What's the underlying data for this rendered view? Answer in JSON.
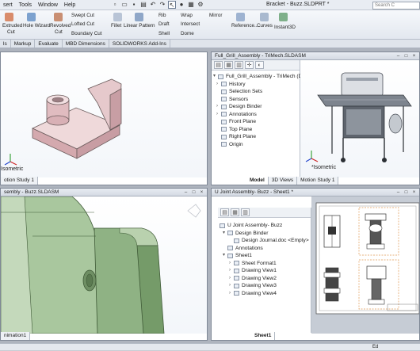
{
  "menubar": {
    "items": [
      "sert",
      "Tools",
      "Window",
      "Help"
    ]
  },
  "doc_title": "Bracket - Buzz.SLDPRT *",
  "search_placeholder": "Search C",
  "ribbon": {
    "extruded_cut": "Extruded",
    "extruded_cut2": "Cut",
    "hole_wizard": "Hole Wizard",
    "revolved_cut": "Revolved",
    "revolved_cut2": "Cut",
    "swept_cut": "Swept Cut",
    "lofted_cut": "Lofted Cut",
    "boundary_cut": "Boundary Cut",
    "fillet": "Fillet",
    "linear_pattern": "Linear Pattern",
    "rib": "Rib",
    "draft": "Draft",
    "shell": "Shell",
    "wrap": "Wrap",
    "intersect": "Intersect",
    "dome": "Dome",
    "mirror": "Mirror",
    "reference": "Reference...",
    "curves": "Curves",
    "instant3d": "Instant3D"
  },
  "cm_tabs": [
    "ls",
    "Markup",
    "Evaluate",
    "MBD Dimensions",
    "SOLIDWORKS Add-Ins"
  ],
  "win_tl": {
    "view_label": "Isometric",
    "tab": "otion Study 1"
  },
  "win_tr": {
    "title": "Full_Grill_Assembly - TriMech.SLDASM",
    "tree": [
      "Full_Grill_Assembly - TriMech (Defa",
      "History",
      "Selection Sets",
      "Sensors",
      "Design Binder",
      "Annotations",
      "Front Plane",
      "Top Plane",
      "Right Plane",
      "Origin"
    ],
    "view_label": "*Isometric",
    "tabs": [
      "Model",
      "3D Views",
      "Motion Study 1"
    ]
  },
  "win_bl": {
    "title": "sembly - Buzz.SLDASM",
    "tab": "nimation1"
  },
  "win_br": {
    "title": "U Joint Assembly- Buzz - Sheet1 *",
    "tree": [
      "U Joint Assembly- Buzz",
      "Design Binder",
      "Design Journal.doc <Empty>",
      "Annotations",
      "Sheet1",
      "Sheet Format1",
      "Drawing View1",
      "Drawing View2",
      "Drawing View3",
      "Drawing View4"
    ],
    "sheet_tab": "Sheet1"
  },
  "status_text": "Ed"
}
